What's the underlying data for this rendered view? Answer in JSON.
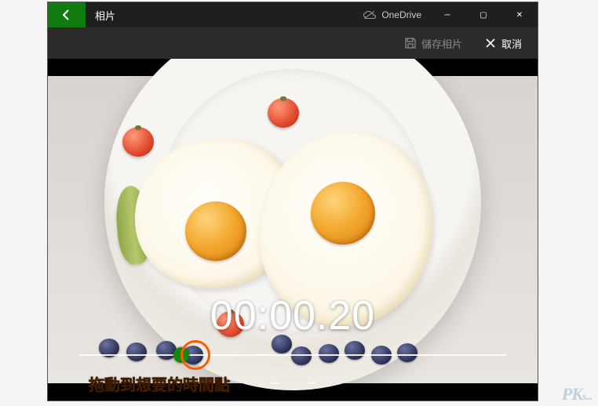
{
  "titlebar": {
    "app_title": "相片",
    "onedrive_label": "OneDrive"
  },
  "window_controls": {
    "minimize": "─",
    "maximize": "▢",
    "close": "✕"
  },
  "toolbar": {
    "save_label": "儲存相片",
    "cancel_label": "取消"
  },
  "player": {
    "timecode": "00:00.20",
    "scrub_percent": 22
  },
  "nav": {
    "prev": "←",
    "next": "→"
  },
  "annotation": {
    "hint_text": "拖動到想要的時間點"
  },
  "watermark": {
    "text_main": "PK",
    "text_sub": "s..."
  },
  "icons": {
    "back": "back-arrow",
    "onedrive": "cloud",
    "save": "floppy",
    "cancel": "x"
  }
}
